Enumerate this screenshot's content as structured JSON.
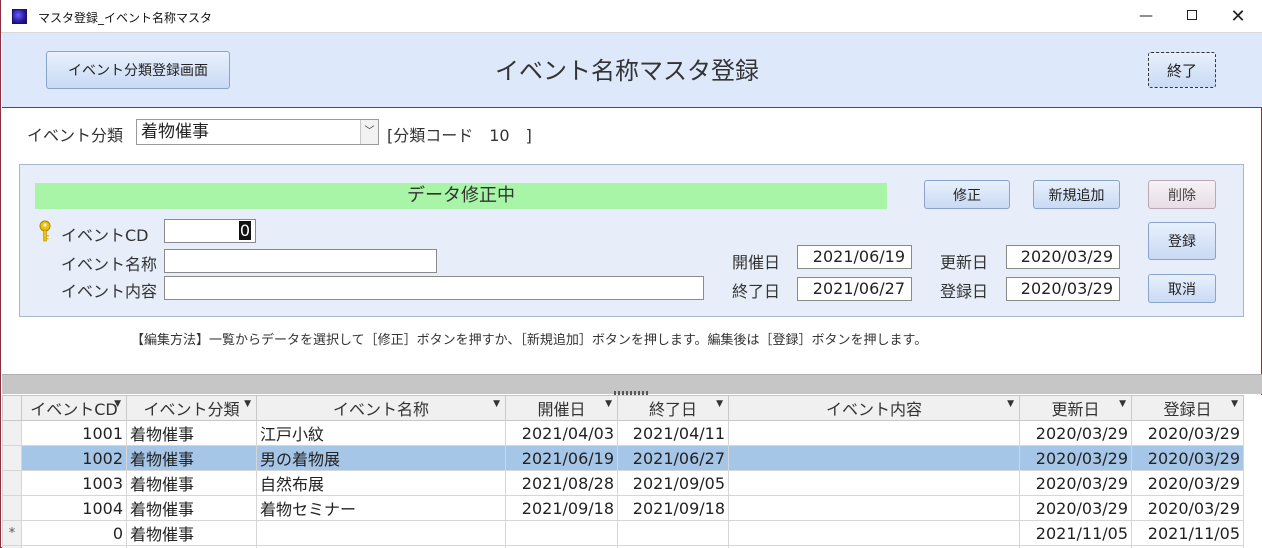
{
  "window": {
    "title": "マスタ登録_イベント名称マスタ",
    "minimize": "—",
    "close": "✕"
  },
  "header": {
    "category_button": "イベント分類登録画面",
    "title": "イベント名称マスタ登録",
    "exit_button": "終了"
  },
  "category": {
    "label": "イベント分類",
    "selected": "着物催事",
    "code_text": "[分類コード　10　]"
  },
  "panel": {
    "status": "データ修正中",
    "buttons": {
      "edit": "修正",
      "new": "新規追加",
      "delete": "削除",
      "register": "登録",
      "cancel": "取消"
    },
    "fields": {
      "event_cd_label": "イベントCD",
      "event_cd_value": "0",
      "event_name_label": "イベント名称",
      "event_name_value": "",
      "event_detail_label": "イベント内容",
      "event_detail_value": ""
    },
    "dates": {
      "start_label": "開催日",
      "start_value": "2021/06/19",
      "end_label": "終了日",
      "end_value": "2021/06/27",
      "updated_label": "更新日",
      "updated_value": "2020/03/29",
      "created_label": "登録日",
      "created_value": "2020/03/29"
    }
  },
  "help_text": "【編集方法】一覧からデータを選択して［修正］ボタンを押すか、［新規追加］ボタンを押します。編集後は［登録］ボタンを押します。",
  "table": {
    "headers": [
      "イベントCD",
      "イベント分類",
      "イベント名称",
      "開催日",
      "終了日",
      "イベント内容",
      "更新日",
      "登録日"
    ],
    "rows": [
      {
        "cd": "1001",
        "category": "着物催事",
        "name": "江戸小紋",
        "start": "2021/04/03",
        "end": "2021/04/11",
        "detail": "",
        "updated": "2020/03/29",
        "created": "2020/03/29"
      },
      {
        "cd": "1002",
        "category": "着物催事",
        "name": "男の着物展",
        "start": "2021/06/19",
        "end": "2021/06/27",
        "detail": "",
        "updated": "2020/03/29",
        "created": "2020/03/29"
      },
      {
        "cd": "1003",
        "category": "着物催事",
        "name": "自然布展",
        "start": "2021/08/28",
        "end": "2021/09/05",
        "detail": "",
        "updated": "2020/03/29",
        "created": "2020/03/29"
      },
      {
        "cd": "1004",
        "category": "着物催事",
        "name": "着物セミナー",
        "start": "2021/09/18",
        "end": "2021/09/18",
        "detail": "",
        "updated": "2020/03/29",
        "created": "2020/03/29"
      },
      {
        "cd": "0",
        "category": "着物催事",
        "name": "",
        "start": "",
        "end": "",
        "detail": "",
        "updated": "2021/11/05",
        "created": "2021/11/05"
      }
    ],
    "new_row_marker": "*"
  },
  "colors": {
    "header_bg": "#dde9fb",
    "status_green": "#a8f5a8",
    "selected_row": "#a6c6e8",
    "window_border": "#8a3040"
  }
}
